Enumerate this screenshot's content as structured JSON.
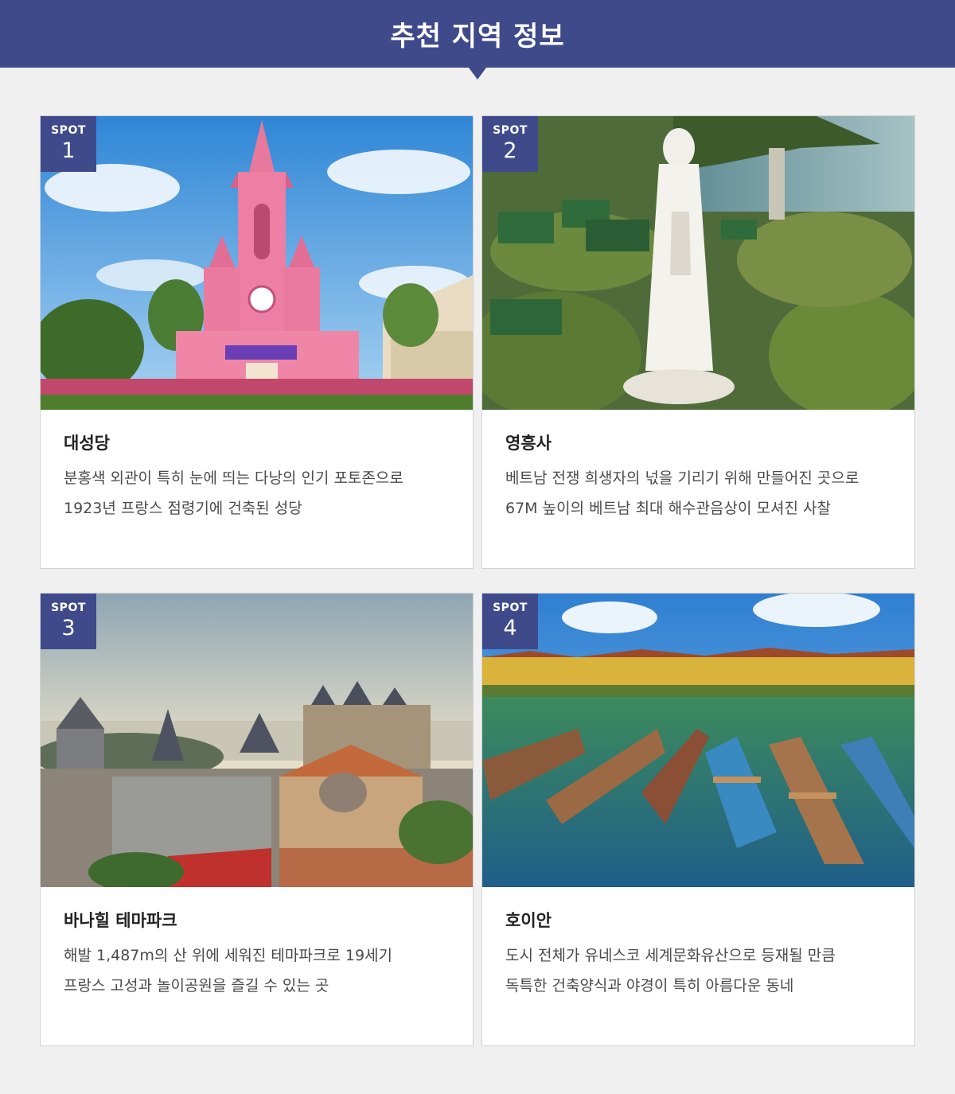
{
  "header": {
    "title": "추천 지역 정보"
  },
  "spots": [
    {
      "badge_label": "SPOT",
      "number": "1",
      "title": "대성당",
      "description": "분홍색 외관이 특히 눈에 띄는 다낭의 인기 포토존으로 1923년 프랑스 점령기에 건축된 성당",
      "image_icon": "pink-cathedral-photo"
    },
    {
      "badge_label": "SPOT",
      "number": "2",
      "title": "영흥사",
      "description": "베트남 전쟁 희생자의 넋을 기리기 위해 만들어진 곳으로 67M 높이의 베트남 최대 해수관음상이 모셔진 사찰",
      "image_icon": "lady-buddha-statue-photo"
    },
    {
      "badge_label": "SPOT",
      "number": "3",
      "title": "바나힐 테마파크",
      "description": "해발 1,487m의 산 위에 세워진 테마파크로 19세기 프랑스 고성과 놀이공원을 즐길 수 있는 곳",
      "image_icon": "french-castle-village-photo"
    },
    {
      "badge_label": "SPOT",
      "number": "4",
      "title": "호이안",
      "description": "도시 전체가 유네스코 세계문화유산으로 등재될 만큼 독특한 건축양식과 야경이 특히 아름다운 동네",
      "image_icon": "wooden-boats-river-photo"
    }
  ],
  "colors": {
    "header_bg": "#3f4a8b",
    "badge_bg": "#3f4a8b",
    "page_bg": "#f0f0f0"
  }
}
